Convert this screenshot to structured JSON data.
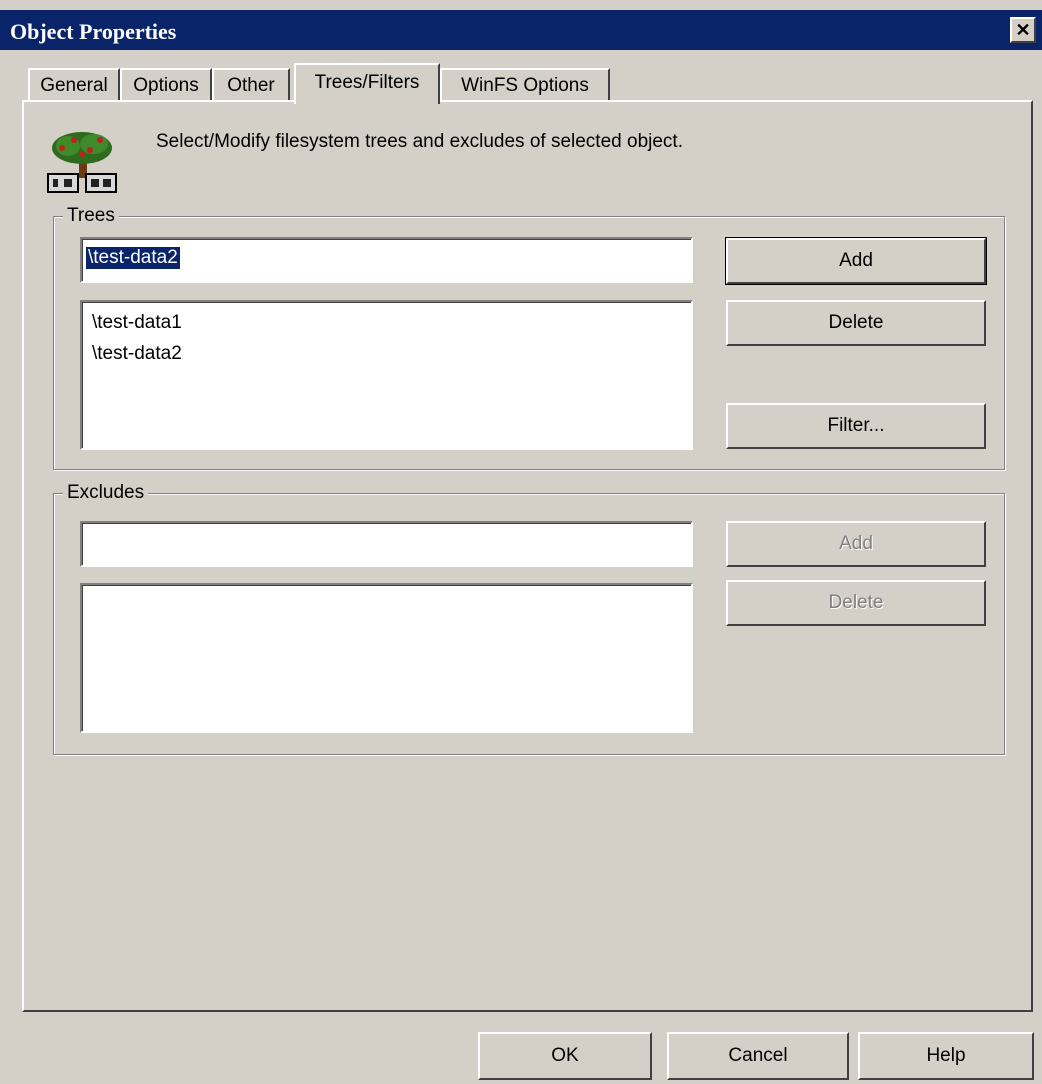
{
  "window": {
    "title": "Object Properties",
    "close_glyph": "✕"
  },
  "tabs": [
    {
      "label": "General",
      "active": false
    },
    {
      "label": "Options",
      "active": false
    },
    {
      "label": "Other",
      "active": false
    },
    {
      "label": "Trees/Filters",
      "active": true
    },
    {
      "label": "WinFS Options",
      "active": false
    }
  ],
  "header": {
    "icon": "tree-building-icon",
    "description": "Select/Modify filesystem trees and excludes of selected object."
  },
  "trees": {
    "legend": "Trees",
    "input_value": "\\test-data2",
    "items": [
      "\\test-data1",
      "\\test-data2"
    ],
    "add_label": "Add",
    "delete_label": "Delete",
    "filter_label": "Filter..."
  },
  "excludes": {
    "legend": "Excludes",
    "input_value": "",
    "items": [],
    "add_label": "Add",
    "delete_label": "Delete"
  },
  "footer": {
    "ok_label": "OK",
    "cancel_label": "Cancel",
    "help_label": "Help"
  },
  "colors": {
    "titlebar": "#0a246a",
    "face": "#d4d0c8",
    "selection": "#0a246a"
  }
}
